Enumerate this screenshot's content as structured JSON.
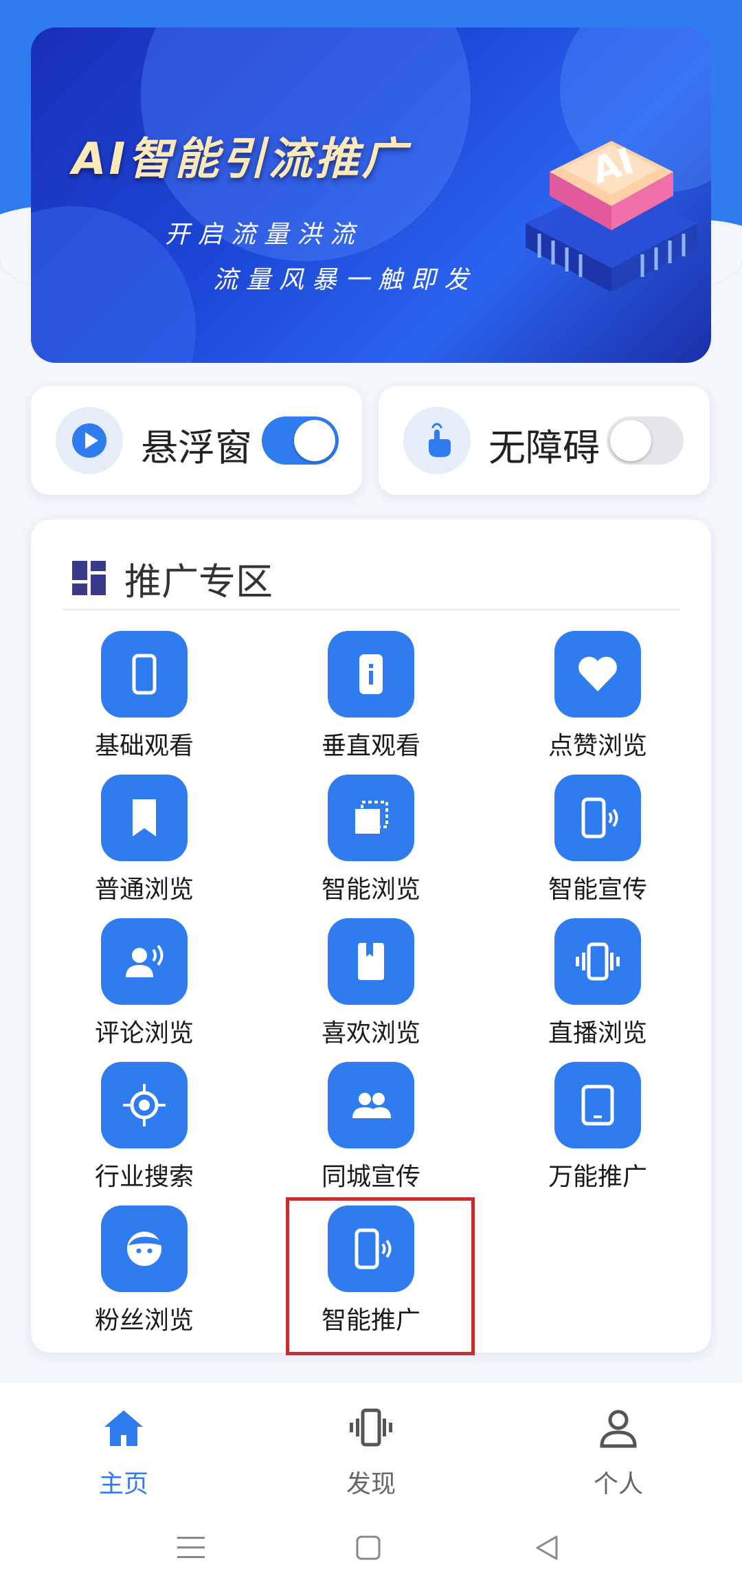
{
  "banner": {
    "title": "AI智能引流推广",
    "line1": "开启流量洪流",
    "line2": "流量风暴一触即发",
    "chip_text": "AI"
  },
  "toggles": [
    {
      "label": "悬浮窗",
      "icon": "play-circle-icon",
      "state": "on"
    },
    {
      "label": "无障碍",
      "icon": "touch-hand-icon",
      "state": "off"
    }
  ],
  "promo": {
    "title": "推广专区",
    "items": [
      {
        "label": "基础观看",
        "icon": "phone-icon"
      },
      {
        "label": "垂直观看",
        "icon": "phone-info-icon"
      },
      {
        "label": "点赞浏览",
        "icon": "heart-icon"
      },
      {
        "label": "普通浏览",
        "icon": "bookmark-icon"
      },
      {
        "label": "智能浏览",
        "icon": "layers-select-icon"
      },
      {
        "label": "智能宣传",
        "icon": "phone-wave-icon"
      },
      {
        "label": "评论浏览",
        "icon": "voice-person-icon"
      },
      {
        "label": "喜欢浏览",
        "icon": "book-icon"
      },
      {
        "label": "直播浏览",
        "icon": "vibrate-phone-icon"
      },
      {
        "label": "行业搜索",
        "icon": "target-icon"
      },
      {
        "label": "同城宣传",
        "icon": "people-icon"
      },
      {
        "label": "万能推广",
        "icon": "tablet-icon"
      },
      {
        "label": "粉丝浏览",
        "icon": "face-icon"
      },
      {
        "label": "智能推广",
        "icon": "phone-wave-icon"
      }
    ]
  },
  "nav": [
    {
      "label": "主页",
      "icon": "home-icon",
      "active": true
    },
    {
      "label": "发现",
      "icon": "vibrate-phone-icon",
      "active": false
    },
    {
      "label": "个人",
      "icon": "person-icon",
      "active": false
    }
  ],
  "system_nav": [
    "menu-icon",
    "home-square-icon",
    "back-triangle-icon"
  ],
  "colors": {
    "accent": "#2f7cf0",
    "highlight_border": "#c62f2f",
    "background": "#f3f6fb"
  }
}
